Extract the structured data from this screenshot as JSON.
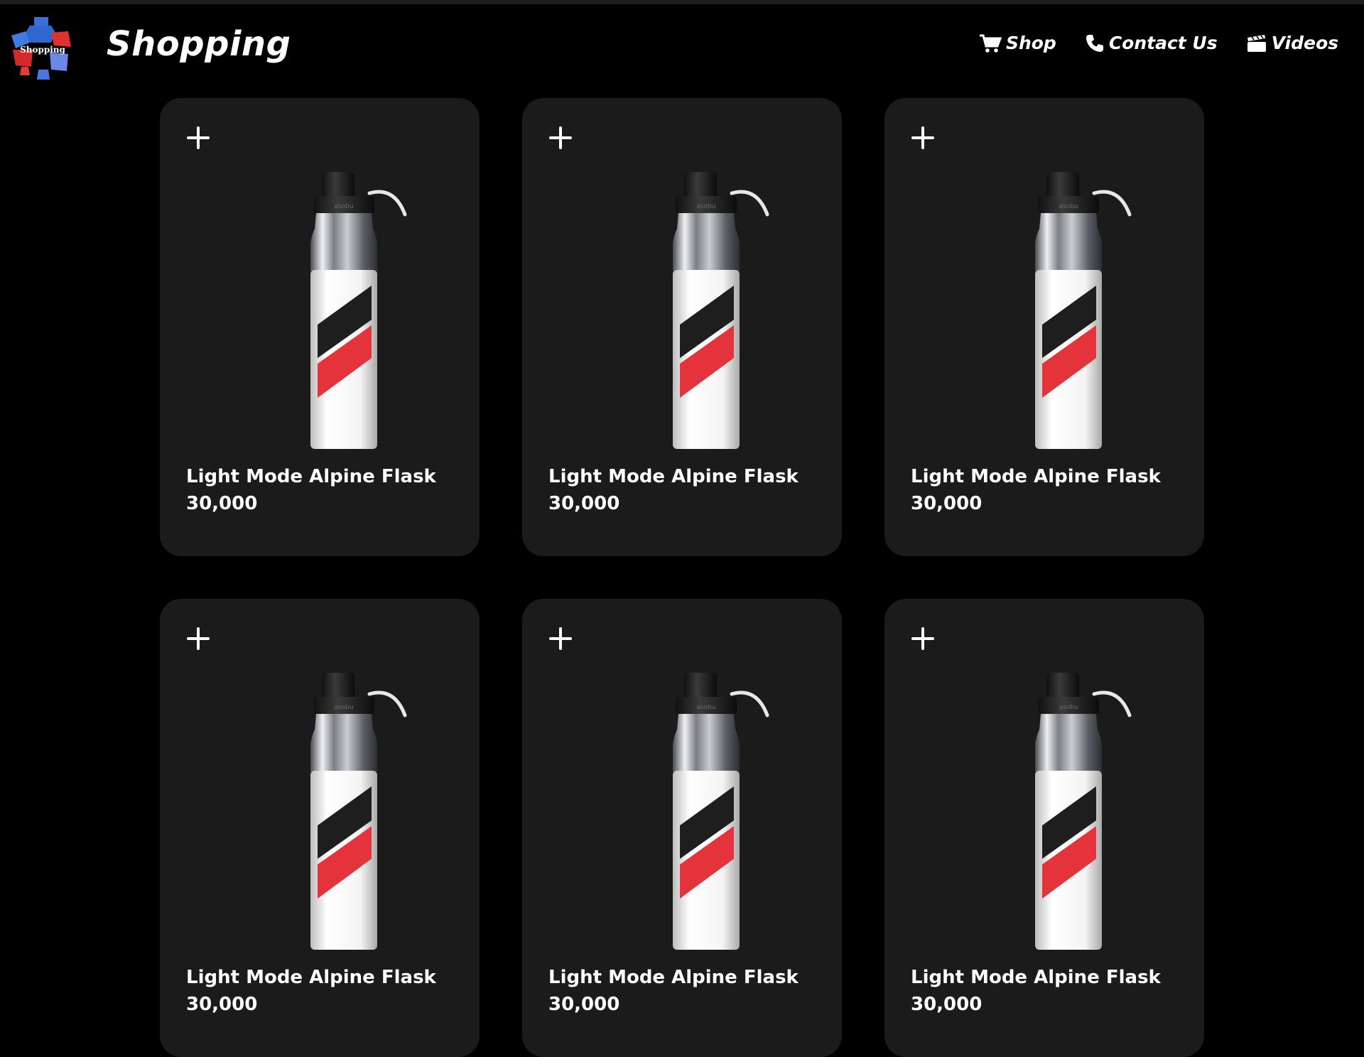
{
  "header": {
    "brand": "Shopping",
    "logo_text": "Shopping",
    "nav": [
      {
        "label": "Shop",
        "icon": "cart-icon"
      },
      {
        "label": "Contact Us",
        "icon": "phone-icon"
      },
      {
        "label": "Videos",
        "icon": "clapperboard-icon"
      }
    ]
  },
  "products": [
    {
      "name": "Light Mode Alpine Flask",
      "price": "30,000"
    },
    {
      "name": "Light Mode Alpine Flask",
      "price": "30,000"
    },
    {
      "name": "Light Mode Alpine Flask",
      "price": "30,000"
    },
    {
      "name": "Light Mode Alpine Flask",
      "price": "30,000"
    },
    {
      "name": "Light Mode Alpine Flask",
      "price": "30,000"
    },
    {
      "name": "Light Mode Alpine Flask",
      "price": "30,000"
    }
  ],
  "colors": {
    "background": "#000000",
    "card": "#1b1b1b",
    "text": "#ffffff",
    "stripe_red": "#e5333b",
    "stripe_black": "#1e1e1e"
  }
}
